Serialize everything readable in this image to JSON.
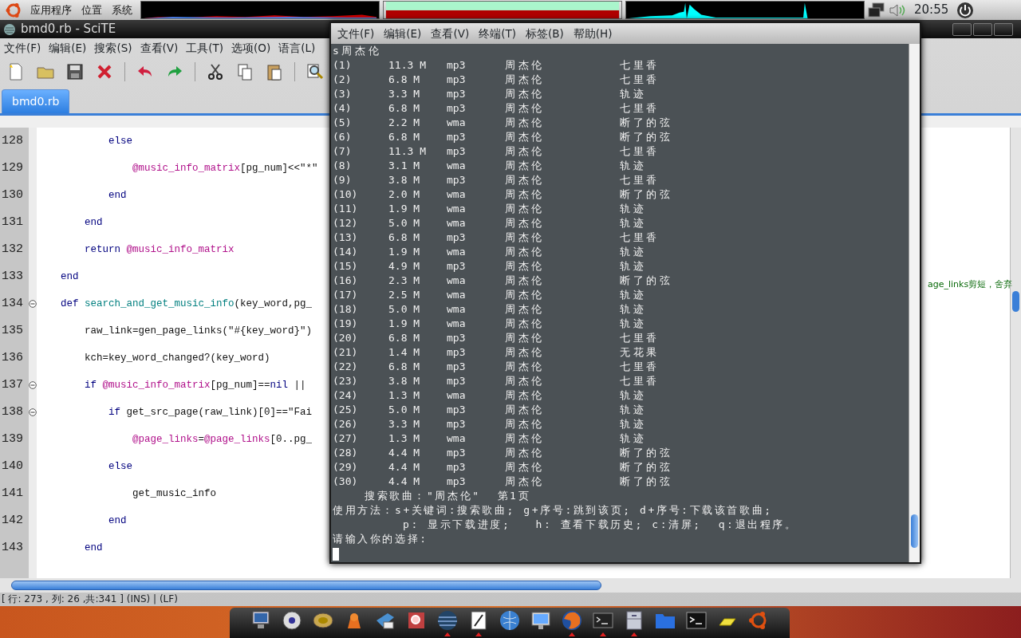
{
  "top_panel": {
    "menus": [
      "应用程序",
      "位置",
      "系统"
    ],
    "clock": "20:55"
  },
  "scite": {
    "title": "bmd0.rb - SciTE",
    "menu": [
      "文件(F)",
      "编辑(E)",
      "搜索(S)",
      "查看(V)",
      "工具(T)",
      "选项(O)",
      "语言(L)"
    ],
    "tabs": [
      {
        "label": "bmd0.rb",
        "selected": true
      }
    ],
    "lines": [
      {
        "number": "128",
        "fold": false,
        "tokens": [
          {
            "text": "            else",
            "kind": "keyword"
          }
        ]
      },
      {
        "number": "129",
        "fold": false,
        "tokens": [
          {
            "text": "                @music_info_matrix",
            "kind": "ivar"
          },
          {
            "text": "[pg_num]<<\"*\"",
            "kind": "plain"
          }
        ]
      },
      {
        "number": "130",
        "fold": false,
        "tokens": [
          {
            "text": "            end",
            "kind": "keyword"
          }
        ]
      },
      {
        "number": "131",
        "fold": false,
        "tokens": [
          {
            "text": "        end",
            "kind": "keyword"
          }
        ]
      },
      {
        "number": "132",
        "fold": false,
        "tokens": [
          {
            "text": "        return ",
            "kind": "keyword"
          },
          {
            "text": "@music_info_matrix",
            "kind": "ivar"
          }
        ]
      },
      {
        "number": "133",
        "fold": false,
        "tokens": [
          {
            "text": "    end",
            "kind": "keyword"
          }
        ]
      },
      {
        "number": "134",
        "fold": true,
        "tokens": [
          {
            "text": "    def ",
            "kind": "keyword"
          },
          {
            "text": "search_and_get_music_info",
            "kind": "defname"
          },
          {
            "text": "(key_word,pg_",
            "kind": "plain"
          }
        ]
      },
      {
        "number": "135",
        "fold": false,
        "tokens": [
          {
            "text": "        raw_link=gen_page_links(\"#{key_word}\")",
            "kind": "plain"
          }
        ]
      },
      {
        "number": "136",
        "fold": false,
        "tokens": [
          {
            "text": "        kch=key_word_changed?(key_word)",
            "kind": "plain"
          }
        ]
      },
      {
        "number": "137",
        "fold": true,
        "tokens": [
          {
            "text": "        if ",
            "kind": "keyword"
          },
          {
            "text": "@music_info_matrix",
            "kind": "ivar"
          },
          {
            "text": "[pg_num]==",
            "kind": "plain"
          },
          {
            "text": "nil",
            "kind": "keyword"
          },
          {
            "text": " ||",
            "kind": "plain"
          }
        ]
      },
      {
        "number": "138",
        "fold": true,
        "tokens": [
          {
            "text": "            if ",
            "kind": "keyword"
          },
          {
            "text": "get_src_page(raw_link)[0]==\"Fai",
            "kind": "plain"
          }
        ]
      },
      {
        "number": "139",
        "fold": false,
        "tokens": [
          {
            "text": "                @page_links",
            "kind": "ivar"
          },
          {
            "text": "=",
            "kind": "plain"
          },
          {
            "text": "@page_links",
            "kind": "ivar"
          },
          {
            "text": "[0..pg_",
            "kind": "plain"
          }
        ]
      },
      {
        "number": "140",
        "fold": false,
        "tokens": [
          {
            "text": "            else",
            "kind": "keyword"
          }
        ]
      },
      {
        "number": "141",
        "fold": false,
        "tokens": [
          {
            "text": "                get_music_info",
            "kind": "plain"
          }
        ]
      },
      {
        "number": "142",
        "fold": false,
        "tokens": [
          {
            "text": "            end",
            "kind": "keyword"
          }
        ]
      },
      {
        "number": "143",
        "fold": false,
        "tokens": [
          {
            "text": "        end",
            "kind": "keyword"
          }
        ]
      }
    ],
    "side_comment": "age_links剪短，舍弃",
    "status_bar": "[ 行: 273 , 列: 26 ,共:341 ] (INS) | (LF)"
  },
  "terminal": {
    "menu": [
      "文件(F)",
      "编辑(E)",
      "查看(V)",
      "终端(T)",
      "标签(B)",
      "帮助(H)"
    ],
    "command": "s周杰伦",
    "rows": [
      [
        "(1)",
        "11.3 M",
        "mp3",
        "周杰伦",
        "七里香"
      ],
      [
        "(2)",
        "6.8 M",
        "mp3",
        "周杰伦",
        "七里香"
      ],
      [
        "(3)",
        "3.3 M",
        "mp3",
        "周杰伦",
        "轨迹"
      ],
      [
        "(4)",
        "6.8 M",
        "mp3",
        "周杰伦",
        "七里香"
      ],
      [
        "(5)",
        "2.2 M",
        "wma",
        "周杰伦",
        "断了的弦"
      ],
      [
        "(6)",
        "6.8 M",
        "mp3",
        "周杰伦",
        "断了的弦"
      ],
      [
        "(7)",
        "11.3 M",
        "mp3",
        "周杰伦",
        "七里香"
      ],
      [
        "(8)",
        "3.1 M",
        "wma",
        "周杰伦",
        "轨迹"
      ],
      [
        "(9)",
        "3.8 M",
        "mp3",
        "周杰伦",
        "七里香"
      ],
      [
        "(10)",
        "2.0 M",
        "wma",
        "周杰伦",
        "断了的弦"
      ],
      [
        "(11)",
        "1.9 M",
        "wma",
        "周杰伦",
        "轨迹"
      ],
      [
        "(12)",
        "5.0 M",
        "wma",
        "周杰伦",
        "轨迹"
      ],
      [
        "(13)",
        "6.8 M",
        "mp3",
        "周杰伦",
        "七里香"
      ],
      [
        "(14)",
        "1.9 M",
        "wma",
        "周杰伦",
        "轨迹"
      ],
      [
        "(15)",
        "4.9 M",
        "mp3",
        "周杰伦",
        "轨迹"
      ],
      [
        "(16)",
        "2.3 M",
        "wma",
        "周杰伦",
        "断了的弦"
      ],
      [
        "(17)",
        "2.5 M",
        "wma",
        "周杰伦",
        "轨迹"
      ],
      [
        "(18)",
        "5.0 M",
        "wma",
        "周杰伦",
        "轨迹"
      ],
      [
        "(19)",
        "1.9 M",
        "wma",
        "周杰伦",
        "轨迹"
      ],
      [
        "(20)",
        "6.8 M",
        "mp3",
        "周杰伦",
        "七里香"
      ],
      [
        "(21)",
        "1.4 M",
        "mp3",
        "周杰伦",
        "无花果"
      ],
      [
        "(22)",
        "6.8 M",
        "mp3",
        "周杰伦",
        "七里香"
      ],
      [
        "(23)",
        "3.8 M",
        "mp3",
        "周杰伦",
        "七里香"
      ],
      [
        "(24)",
        "1.3 M",
        "wma",
        "周杰伦",
        "轨迹"
      ],
      [
        "(25)",
        "5.0 M",
        "mp3",
        "周杰伦",
        "轨迹"
      ],
      [
        "(26)",
        "3.3 M",
        "mp3",
        "周杰伦",
        "轨迹"
      ],
      [
        "(27)",
        "1.3 M",
        "wma",
        "周杰伦",
        "轨迹"
      ],
      [
        "(28)",
        "4.4 M",
        "mp3",
        "周杰伦",
        "断了的弦"
      ],
      [
        "(29)",
        "4.4 M",
        "mp3",
        "周杰伦",
        "断了的弦"
      ],
      [
        "(30)",
        "4.4 M",
        "mp3",
        "周杰伦",
        "断了的弦"
      ]
    ],
    "footer": [
      {
        "kind": "banner",
        "text": "搜索歌曲：\"周杰伦\"  第1页"
      },
      {
        "kind": "help",
        "text": "使用方法：s+关键词:搜索歌曲; g+序号:跳到该页; d+序号:下载该首歌曲;"
      },
      {
        "kind": "help-cont",
        "text": "p: 显示下载进度;   h: 查看下载历史; c:清屏;  q:退出程序。"
      },
      {
        "kind": "prompt",
        "text": "请输入你的选择:"
      }
    ]
  },
  "dock": [
    {
      "running": false
    },
    {
      "running": false
    },
    {
      "running": false
    },
    {
      "running": false
    },
    {
      "running": false
    },
    {
      "running": false
    },
    {
      "running": true
    },
    {
      "running": true
    },
    {
      "running": false
    },
    {
      "running": false
    },
    {
      "running": true
    },
    {
      "running": true
    },
    {
      "running": true
    },
    {
      "running": false
    },
    {
      "running": false
    },
    {
      "running": false
    },
    {
      "running": false
    }
  ]
}
